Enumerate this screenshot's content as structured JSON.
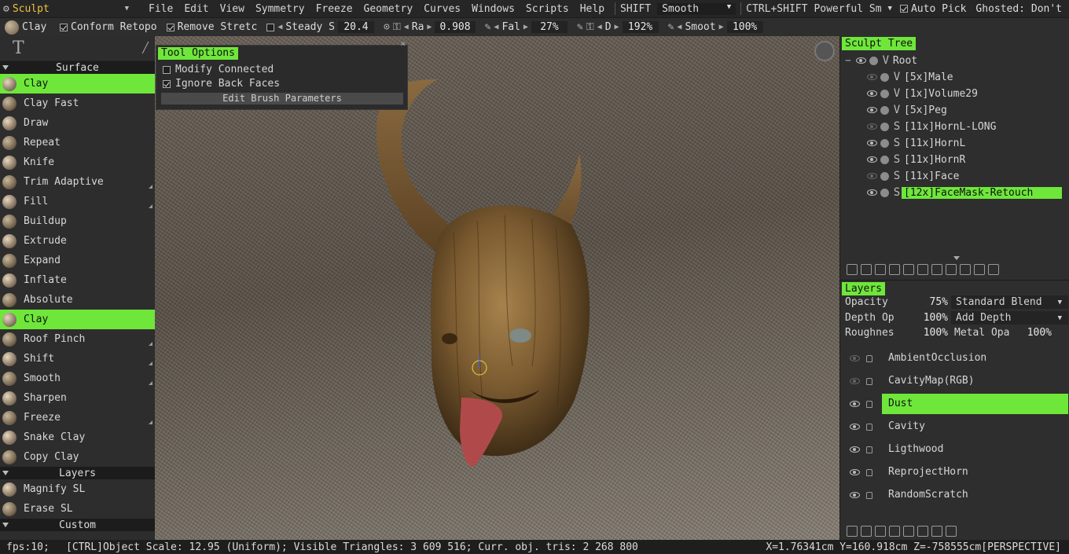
{
  "menubar": {
    "workspace": "Sculpt",
    "items": [
      "File",
      "Edit",
      "View",
      "Symmetry",
      "Freeze",
      "Geometry",
      "Curves",
      "Windows",
      "Scripts",
      "Help"
    ],
    "shift_label": "SHIFT",
    "shift_value": "Smooth",
    "ctrlshift_label": "CTRL+SHIFT",
    "ctrlshift_value": "Powerful Sm",
    "autopick_label": "Auto Pick",
    "ghosted_label": "Ghosted: Don't"
  },
  "toolbar": {
    "tool_name": "Clay",
    "conform_retopo": "Conform Retopo",
    "remove_stretch": "Remove Stretc",
    "steady_label": "Steady S",
    "steady_value": "20.4",
    "radius_label": "Ra",
    "radius_value": "0.908",
    "falloff_label": "Fal",
    "falloff_value": "27%",
    "depth_label": "D",
    "depth_value": "192%",
    "smooth_label": "Smoot",
    "smooth_value": "100%"
  },
  "tool_options": {
    "title": "Tool Options",
    "modify_connected": "Modify Connected",
    "ignore_back_faces": "Ignore Back Faces",
    "edit_brush_params": "Edit Brush Parameters"
  },
  "left_panel": {
    "sections": [
      {
        "name": "Surface",
        "brushes": [
          {
            "label": "Clay",
            "selected": true,
            "more": false
          },
          {
            "label": "Clay Fast",
            "selected": false,
            "more": false
          },
          {
            "label": "Draw",
            "selected": false,
            "more": false
          },
          {
            "label": "Repeat",
            "selected": false,
            "more": false
          },
          {
            "label": "Knife",
            "selected": false,
            "more": false
          },
          {
            "label": "Trim Adaptive",
            "selected": false,
            "more": true
          },
          {
            "label": "Fill",
            "selected": false,
            "more": true
          },
          {
            "label": "Buildup",
            "selected": false,
            "more": false
          },
          {
            "label": "Extrude",
            "selected": false,
            "more": false
          },
          {
            "label": "Expand",
            "selected": false,
            "more": false
          },
          {
            "label": "Inflate",
            "selected": false,
            "more": false
          },
          {
            "label": "Absolute",
            "selected": false,
            "more": false
          },
          {
            "label": "Clay",
            "selected": true,
            "more": false
          },
          {
            "label": "Roof Pinch",
            "selected": false,
            "more": true
          },
          {
            "label": "Shift",
            "selected": false,
            "more": true
          },
          {
            "label": "Smooth",
            "selected": false,
            "more": true
          },
          {
            "label": "Sharpen",
            "selected": false,
            "more": false
          },
          {
            "label": "Freeze",
            "selected": false,
            "more": true
          },
          {
            "label": "Snake Clay",
            "selected": false,
            "more": false
          },
          {
            "label": "Copy Clay",
            "selected": false,
            "more": false
          }
        ]
      },
      {
        "name": "Layers",
        "brushes": [
          {
            "label": "Magnify SL",
            "selected": false,
            "more": false
          },
          {
            "label": "Erase SL",
            "selected": false,
            "more": false
          }
        ]
      },
      {
        "name": "Custom",
        "brushes": []
      }
    ]
  },
  "sculpt_tree": {
    "title": "Sculpt Tree",
    "nodes": [
      {
        "type": "V",
        "label": "Root",
        "visible": true,
        "selected": false
      },
      {
        "type": "V",
        "label": "[5x]Male",
        "visible": false,
        "selected": false
      },
      {
        "type": "V",
        "label": "[1x]Volume29",
        "visible": true,
        "selected": false
      },
      {
        "type": "V",
        "label": "[5x]Peg",
        "visible": true,
        "selected": false
      },
      {
        "type": "S",
        "label": "[11x]HornL-LONG",
        "visible": false,
        "selected": false
      },
      {
        "type": "S",
        "label": "[11x]HornL",
        "visible": true,
        "selected": false
      },
      {
        "type": "S",
        "label": "[11x]HornR",
        "visible": true,
        "selected": false
      },
      {
        "type": "S",
        "label": "[11x]Face",
        "visible": false,
        "selected": false
      },
      {
        "type": "S",
        "label": "[12x]FaceMask-Retouch",
        "visible": true,
        "selected": true
      }
    ]
  },
  "layers": {
    "title": "Layers",
    "opacity_label": "Opacity",
    "opacity_value": "75%",
    "blend_mode": "Standard Blend",
    "depth_label": "Depth Op",
    "depth_value": "100%",
    "depth_mode": "Add Depth",
    "rough_label": "Roughnes",
    "rough_value": "100%",
    "metal_label": "Metal Opa",
    "metal_value": "100%",
    "items": [
      {
        "label": "AmbientOcclusion",
        "visible": false,
        "selected": false
      },
      {
        "label": "CavityMap(RGB)",
        "visible": false,
        "selected": false
      },
      {
        "label": "Dust",
        "visible": true,
        "selected": true
      },
      {
        "label": "Cavity",
        "visible": true,
        "selected": false
      },
      {
        "label": "Ligthwood",
        "visible": true,
        "selected": false
      },
      {
        "label": "ReprojectHorn",
        "visible": true,
        "selected": false
      },
      {
        "label": "RandomScratch",
        "visible": true,
        "selected": false
      }
    ]
  },
  "status": {
    "fps": "fps:10;",
    "info": "[CTRL]Object Scale: 12.95 (Uniform); Visible Triangles: 3 609 516; Curr. obj. tris: 2 268 800",
    "coords": "X=1.76341cm Y=160.918cm Z=-758555cm[PERSPECTIVE]"
  },
  "colors": {
    "accent": "#6ee73a",
    "workspace": "#f0c040"
  }
}
